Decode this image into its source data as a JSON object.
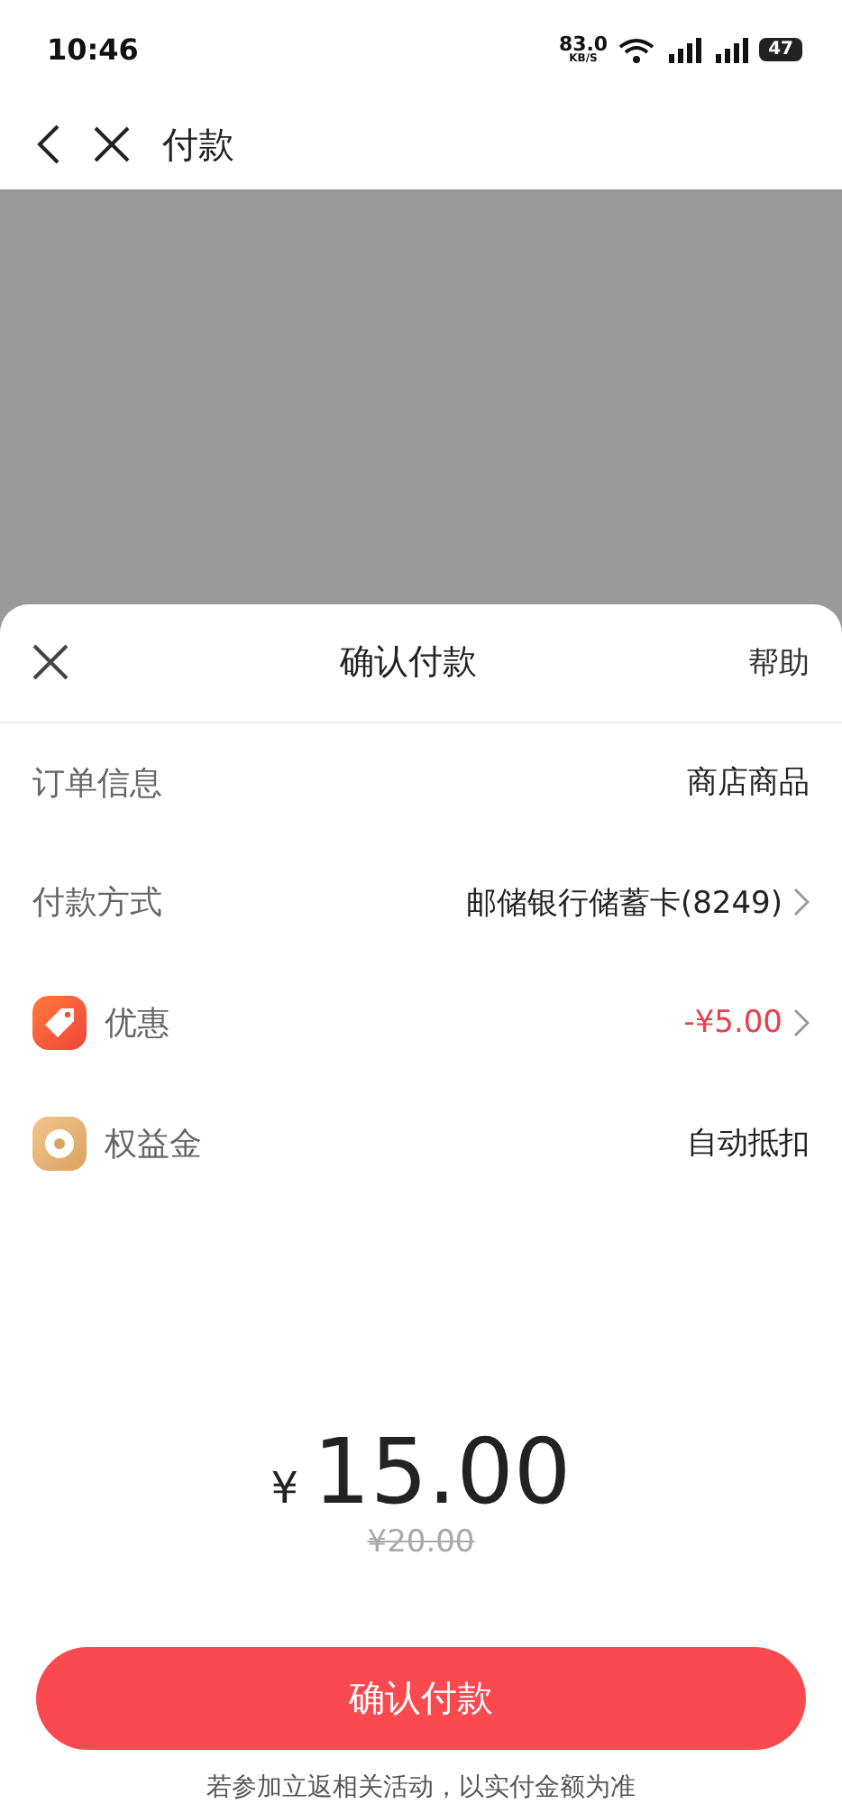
{
  "status_bar": {
    "time": "10:46",
    "net_speed": "83.0",
    "net_unit": "KB/S",
    "battery": "47"
  },
  "header": {
    "title": "付款"
  },
  "sheet": {
    "title": "确认付款",
    "help": "帮助",
    "rows": [
      {
        "label": "订单信息",
        "value": "商店商品",
        "kind": "plain",
        "chevron": false,
        "negative": false
      },
      {
        "label": "付款方式",
        "value": "邮储银行储蓄卡(8249)",
        "kind": "plain",
        "chevron": true,
        "negative": false
      },
      {
        "label": "优惠",
        "value": "-¥5.00",
        "kind": "discount",
        "chevron": true,
        "negative": true
      },
      {
        "label": "权益金",
        "value": "自动抵扣",
        "kind": "benefit",
        "chevron": false,
        "negative": false
      }
    ],
    "amount": {
      "currency": "¥",
      "value": "15.00",
      "original": "¥20.00"
    },
    "button": "确认付款",
    "note": "若参加立返相关活动，以实付金额为准"
  }
}
